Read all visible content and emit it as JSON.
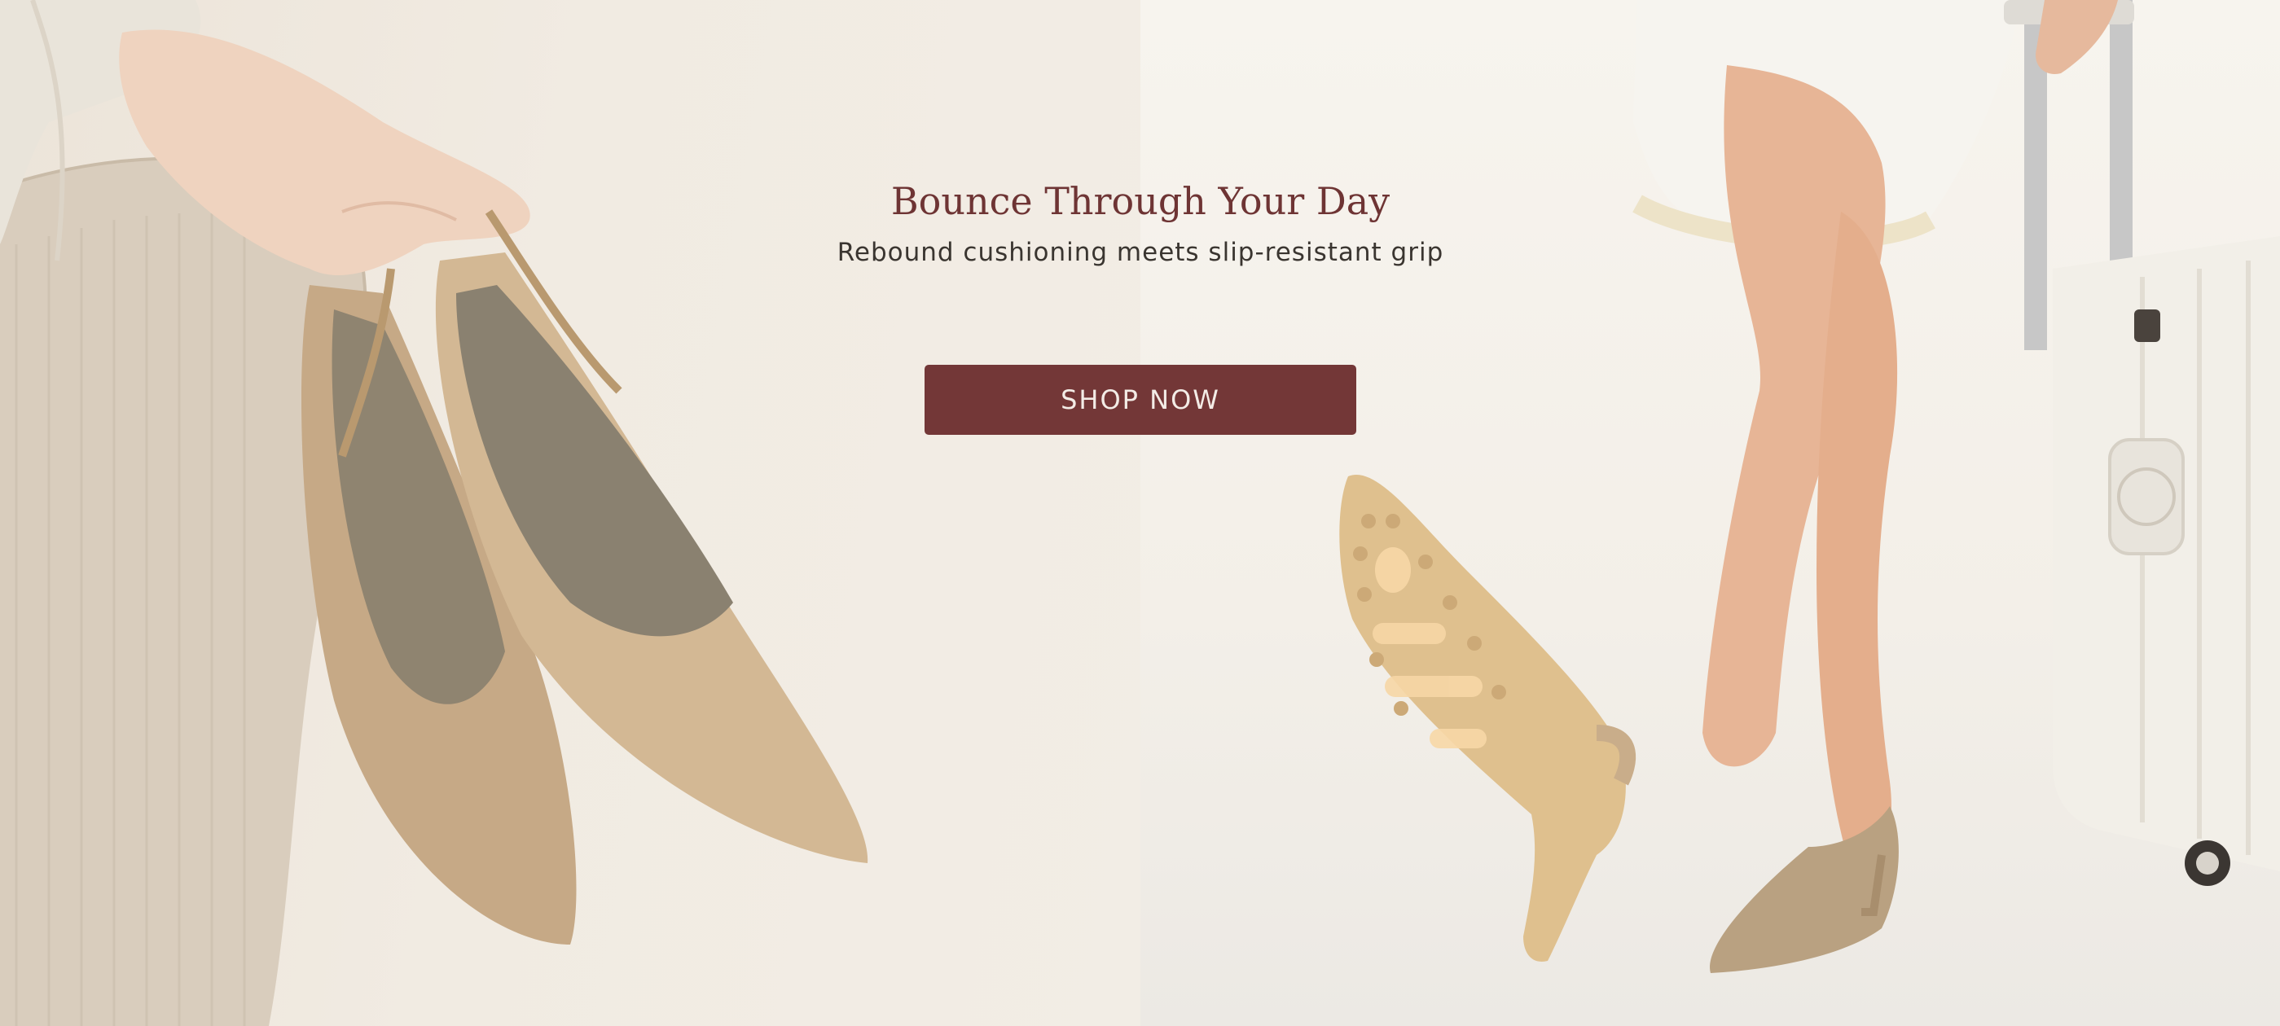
{
  "hero": {
    "headline": "Bounce Through Your Day",
    "subheadline": "Rebound cushioning meets slip-resistant grip",
    "cta_label": "SHOP NOW"
  },
  "colors": {
    "accent": "#733737",
    "headline": "#6e3434",
    "background": "#f3efe8",
    "shoe": "#c9ad8a"
  }
}
